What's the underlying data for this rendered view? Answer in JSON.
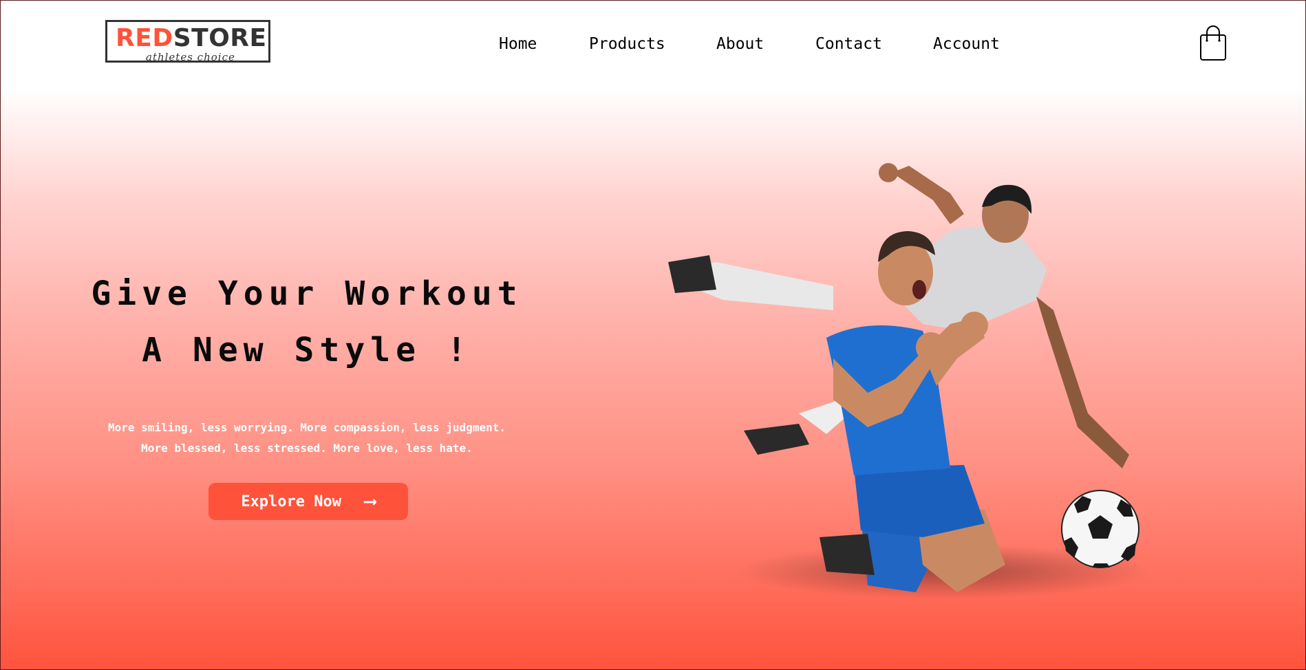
{
  "brand": {
    "logo_part1": "RED",
    "logo_part2": "STORE",
    "tagline": "athletes choice",
    "accent_color": "#ff523b"
  },
  "nav": {
    "items": [
      {
        "label": "Home"
      },
      {
        "label": "Products"
      },
      {
        "label": "About"
      },
      {
        "label": "Contact"
      },
      {
        "label": "Account"
      }
    ],
    "cart_icon": "shopping-bag-icon"
  },
  "hero": {
    "title_line1": "Give Your Workout",
    "title_line2": "A New Style !",
    "subtitle_line1": "More smiling, less worrying. More compassion, less judgment.",
    "subtitle_line2": "More blessed, less stressed. More love, less hate.",
    "button_label": "Explore Now",
    "button_icon": "arrow-right-icon"
  }
}
